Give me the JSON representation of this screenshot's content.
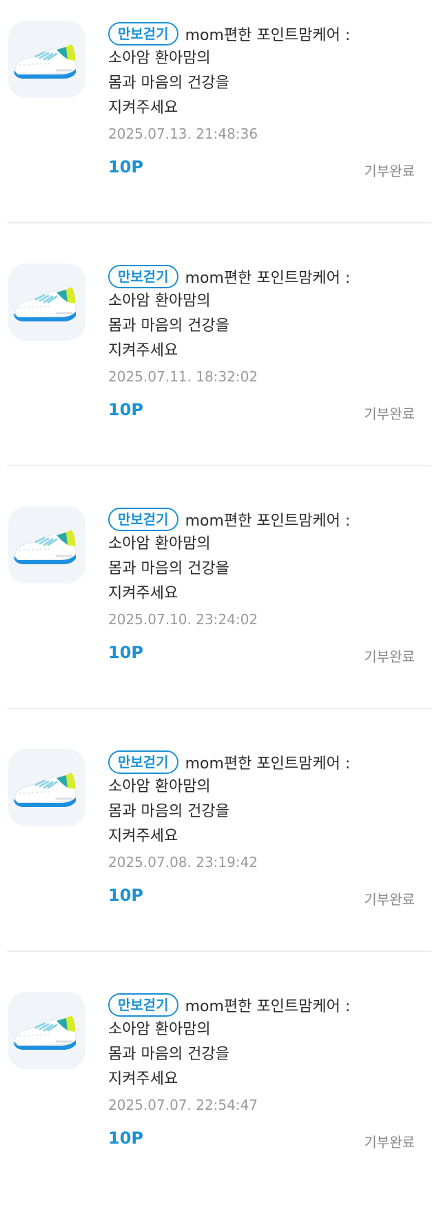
{
  "list": {
    "items": [
      {
        "badge": "만보걷기",
        "title": "mom편한 포인트맘케어 :",
        "desc_1": "소아암 환아맘의",
        "desc_2": "몸과 마음의 건강을",
        "desc_3": "지켜주세요",
        "date": "2025.07.13. 21:48:36",
        "points": "10P",
        "status": "기부완료"
      },
      {
        "badge": "만보걷기",
        "title": "mom편한 포인트맘케어 :",
        "desc_1": "소아암 환아맘의",
        "desc_2": "몸과 마음의 건강을",
        "desc_3": "지켜주세요",
        "date": "2025.07.11. 18:32:02",
        "points": "10P",
        "status": "기부완료"
      },
      {
        "badge": "만보걷기",
        "title": "mom편한 포인트맘케어 :",
        "desc_1": "소아암 환아맘의",
        "desc_2": "몸과 마음의 건강을",
        "desc_3": "지켜주세요",
        "date": "2025.07.10. 23:24:02",
        "points": "10P",
        "status": "기부완료"
      },
      {
        "badge": "만보걷기",
        "title": "mom편한 포인트맘케어 :",
        "desc_1": "소아암 환아맘의",
        "desc_2": "몸과 마음의 건강을",
        "desc_3": "지켜주세요",
        "date": "2025.07.08. 23:19:42",
        "points": "10P",
        "status": "기부완료"
      },
      {
        "badge": "만보걷기",
        "title": "mom편한 포인트맘케어 :",
        "desc_1": "소아암 환아맘의",
        "desc_2": "몸과 마음의 건강을",
        "desc_3": "지켜주세요",
        "date": "2025.07.07. 22:54:47",
        "points": "10P",
        "status": "기부완료"
      }
    ]
  },
  "icons": {
    "thumbnail": "sneaker-icon"
  },
  "colors": {
    "accent": "#1b92d4",
    "text": "#2b2b2b",
    "muted": "#9a9a9a",
    "thumb_bg": "#f1f4f8",
    "divider": "#ececec"
  }
}
